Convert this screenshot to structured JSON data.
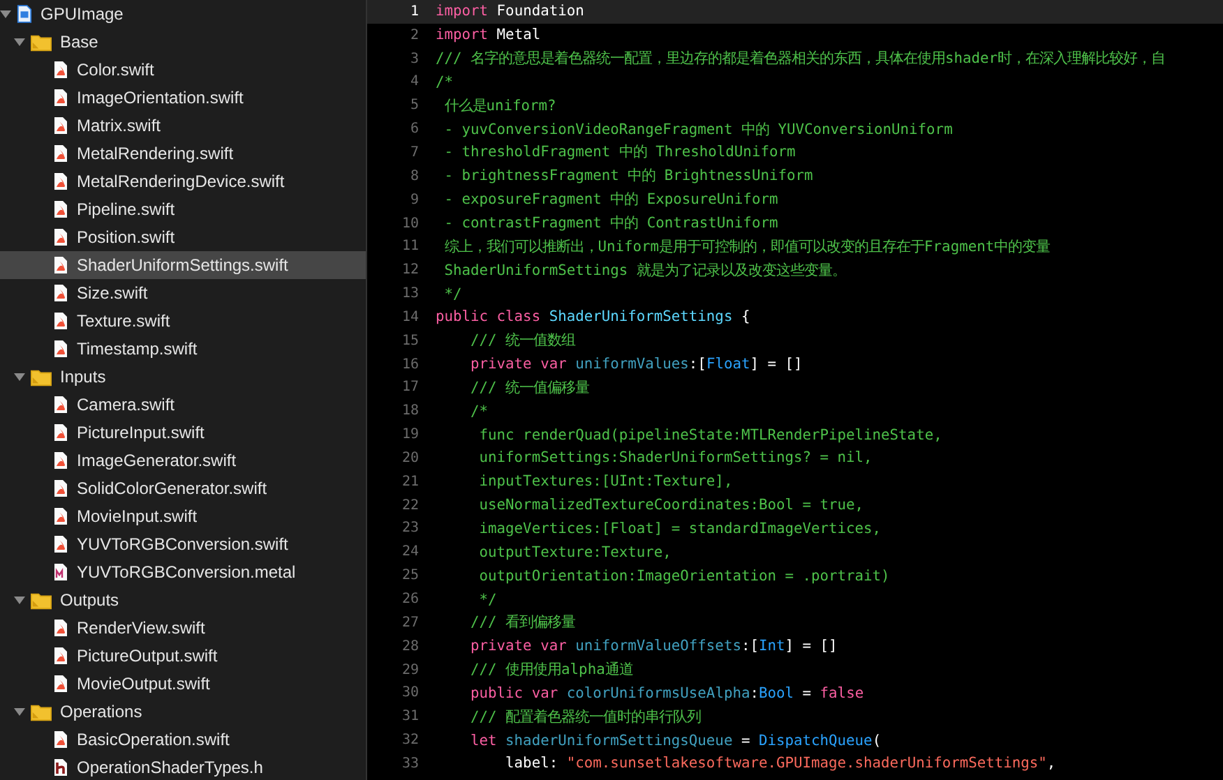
{
  "navigator": {
    "tree": [
      {
        "label": "GPUImage",
        "kind": "project",
        "expanded": true,
        "selected": false,
        "children": [
          {
            "label": "Base",
            "kind": "folder",
            "expanded": true,
            "selected": false,
            "children": [
              {
                "label": "Color.swift",
                "kind": "swift",
                "selected": false
              },
              {
                "label": "ImageOrientation.swift",
                "kind": "swift",
                "selected": false
              },
              {
                "label": "Matrix.swift",
                "kind": "swift",
                "selected": false
              },
              {
                "label": "MetalRendering.swift",
                "kind": "swift",
                "selected": false
              },
              {
                "label": "MetalRenderingDevice.swift",
                "kind": "swift",
                "selected": false
              },
              {
                "label": "Pipeline.swift",
                "kind": "swift",
                "selected": false
              },
              {
                "label": "Position.swift",
                "kind": "swift",
                "selected": false
              },
              {
                "label": "ShaderUniformSettings.swift",
                "kind": "swift",
                "selected": true
              },
              {
                "label": "Size.swift",
                "kind": "swift",
                "selected": false
              },
              {
                "label": "Texture.swift",
                "kind": "swift",
                "selected": false
              },
              {
                "label": "Timestamp.swift",
                "kind": "swift",
                "selected": false
              }
            ]
          },
          {
            "label": "Inputs",
            "kind": "folder",
            "expanded": true,
            "selected": false,
            "children": [
              {
                "label": "Camera.swift",
                "kind": "swift",
                "selected": false
              },
              {
                "label": "PictureInput.swift",
                "kind": "swift",
                "selected": false
              },
              {
                "label": "ImageGenerator.swift",
                "kind": "swift",
                "selected": false
              },
              {
                "label": "SolidColorGenerator.swift",
                "kind": "swift",
                "selected": false
              },
              {
                "label": "MovieInput.swift",
                "kind": "swift",
                "selected": false
              },
              {
                "label": "YUVToRGBConversion.swift",
                "kind": "swift",
                "selected": false
              },
              {
                "label": "YUVToRGBConversion.metal",
                "kind": "metal",
                "selected": false
              }
            ]
          },
          {
            "label": "Outputs",
            "kind": "folder",
            "expanded": true,
            "selected": false,
            "children": [
              {
                "label": "RenderView.swift",
                "kind": "swift",
                "selected": false
              },
              {
                "label": "PictureOutput.swift",
                "kind": "swift",
                "selected": false
              },
              {
                "label": "MovieOutput.swift",
                "kind": "swift",
                "selected": false
              }
            ]
          },
          {
            "label": "Operations",
            "kind": "folder",
            "expanded": true,
            "selected": false,
            "children": [
              {
                "label": "BasicOperation.swift",
                "kind": "swift",
                "selected": false
              },
              {
                "label": "OperationShaderTypes.h",
                "kind": "header",
                "selected": false
              }
            ]
          }
        ]
      }
    ]
  },
  "editor": {
    "lines": [
      {
        "number": "1",
        "current": true,
        "tokens": [
          {
            "kind": "keyword",
            "text": "import"
          },
          {
            "kind": "plain",
            "text": " Foundation"
          }
        ]
      },
      {
        "number": "2",
        "current": false,
        "tokens": [
          {
            "kind": "keyword",
            "text": "import"
          },
          {
            "kind": "plain",
            "text": " Metal"
          }
        ]
      },
      {
        "number": "3",
        "current": false,
        "tokens": [
          {
            "kind": "comment",
            "text": "/// 名字的意思是着色器统一配置，里边存的都是着色器相关的东西，具体在使用shader时，在深入理解比较好，自"
          }
        ]
      },
      {
        "number": "4",
        "current": false,
        "tokens": [
          {
            "kind": "comment",
            "text": "/*"
          }
        ]
      },
      {
        "number": "5",
        "current": false,
        "tokens": [
          {
            "kind": "comment",
            "text": " 什么是uniform?"
          }
        ]
      },
      {
        "number": "6",
        "current": false,
        "tokens": [
          {
            "kind": "comment",
            "text": " - yuvConversionVideoRangeFragment 中的 YUVConversionUniform"
          }
        ]
      },
      {
        "number": "7",
        "current": false,
        "tokens": [
          {
            "kind": "comment",
            "text": " - thresholdFragment 中的 ThresholdUniform"
          }
        ]
      },
      {
        "number": "8",
        "current": false,
        "tokens": [
          {
            "kind": "comment",
            "text": " - brightnessFragment 中的 BrightnessUniform"
          }
        ]
      },
      {
        "number": "9",
        "current": false,
        "tokens": [
          {
            "kind": "comment",
            "text": " - exposureFragment 中的 ExposureUniform"
          }
        ]
      },
      {
        "number": "10",
        "current": false,
        "tokens": [
          {
            "kind": "comment",
            "text": " - contrastFragment 中的 ContrastUniform"
          }
        ]
      },
      {
        "number": "11",
        "current": false,
        "tokens": [
          {
            "kind": "comment",
            "text": " 综上，我们可以推断出，Uniform是用于可控制的，即值可以改变的且存在于Fragment中的变量"
          }
        ]
      },
      {
        "number": "12",
        "current": false,
        "tokens": [
          {
            "kind": "comment",
            "text": " ShaderUniformSettings 就是为了记录以及改变这些变量。"
          }
        ]
      },
      {
        "number": "13",
        "current": false,
        "tokens": [
          {
            "kind": "comment",
            "text": " */"
          }
        ]
      },
      {
        "number": "14",
        "current": false,
        "tokens": [
          {
            "kind": "keyword",
            "text": "public class "
          },
          {
            "kind": "declaration",
            "text": "ShaderUniformSettings"
          },
          {
            "kind": "plain",
            "text": " {"
          }
        ]
      },
      {
        "number": "15",
        "current": false,
        "tokens": [
          {
            "kind": "comment",
            "text": "    /// 统一值数组"
          }
        ]
      },
      {
        "number": "16",
        "current": false,
        "tokens": [
          {
            "kind": "keyword",
            "text": "    private var "
          },
          {
            "kind": "property",
            "text": "uniformValues"
          },
          {
            "kind": "plain",
            "text": ":["
          },
          {
            "kind": "type",
            "text": "Float"
          },
          {
            "kind": "plain",
            "text": "] = []"
          }
        ]
      },
      {
        "number": "17",
        "current": false,
        "tokens": [
          {
            "kind": "comment",
            "text": "    /// 统一值偏移量"
          }
        ]
      },
      {
        "number": "18",
        "current": false,
        "tokens": [
          {
            "kind": "comment",
            "text": "    /*"
          }
        ]
      },
      {
        "number": "19",
        "current": false,
        "tokens": [
          {
            "kind": "comment",
            "text": "     func renderQuad(pipelineState:MTLRenderPipelineState,"
          }
        ]
      },
      {
        "number": "20",
        "current": false,
        "tokens": [
          {
            "kind": "comment",
            "text": "     uniformSettings:ShaderUniformSettings? = nil,"
          }
        ]
      },
      {
        "number": "21",
        "current": false,
        "tokens": [
          {
            "kind": "comment",
            "text": "     inputTextures:[UInt:Texture],"
          }
        ]
      },
      {
        "number": "22",
        "current": false,
        "tokens": [
          {
            "kind": "comment",
            "text": "     useNormalizedTextureCoordinates:Bool = true,"
          }
        ]
      },
      {
        "number": "23",
        "current": false,
        "tokens": [
          {
            "kind": "comment",
            "text": "     imageVertices:[Float] = standardImageVertices,"
          }
        ]
      },
      {
        "number": "24",
        "current": false,
        "tokens": [
          {
            "kind": "comment",
            "text": "     outputTexture:Texture,"
          }
        ]
      },
      {
        "number": "25",
        "current": false,
        "tokens": [
          {
            "kind": "comment",
            "text": "     outputOrientation:ImageOrientation = .portrait)"
          }
        ]
      },
      {
        "number": "26",
        "current": false,
        "tokens": [
          {
            "kind": "comment",
            "text": "     */"
          }
        ]
      },
      {
        "number": "27",
        "current": false,
        "tokens": [
          {
            "kind": "comment",
            "text": "    /// 看到偏移量"
          }
        ]
      },
      {
        "number": "28",
        "current": false,
        "tokens": [
          {
            "kind": "keyword",
            "text": "    private var "
          },
          {
            "kind": "property",
            "text": "uniformValueOffsets"
          },
          {
            "kind": "plain",
            "text": ":["
          },
          {
            "kind": "type",
            "text": "Int"
          },
          {
            "kind": "plain",
            "text": "] = []"
          }
        ]
      },
      {
        "number": "29",
        "current": false,
        "tokens": [
          {
            "kind": "comment",
            "text": "    /// 使用使用alpha通道"
          }
        ]
      },
      {
        "number": "30",
        "current": false,
        "tokens": [
          {
            "kind": "keyword",
            "text": "    public var "
          },
          {
            "kind": "property",
            "text": "colorUniformsUseAlpha"
          },
          {
            "kind": "plain",
            "text": ":"
          },
          {
            "kind": "type",
            "text": "Bool"
          },
          {
            "kind": "plain",
            "text": " = "
          },
          {
            "kind": "keyword",
            "text": "false"
          }
        ]
      },
      {
        "number": "31",
        "current": false,
        "tokens": [
          {
            "kind": "comment",
            "text": "    /// 配置着色器统一值时的串行队列"
          }
        ]
      },
      {
        "number": "32",
        "current": false,
        "tokens": [
          {
            "kind": "keyword",
            "text": "    let "
          },
          {
            "kind": "property",
            "text": "shaderUniformSettingsQueue"
          },
          {
            "kind": "plain",
            "text": " = "
          },
          {
            "kind": "type",
            "text": "DispatchQueue"
          },
          {
            "kind": "plain",
            "text": "("
          }
        ]
      },
      {
        "number": "33",
        "current": false,
        "tokens": [
          {
            "kind": "plain",
            "text": "        label: "
          },
          {
            "kind": "string",
            "text": "\"com.sunsetlakesoftware.GPUImage.shaderUniformSettings\""
          },
          {
            "kind": "plain",
            "text": ","
          }
        ]
      }
    ]
  }
}
